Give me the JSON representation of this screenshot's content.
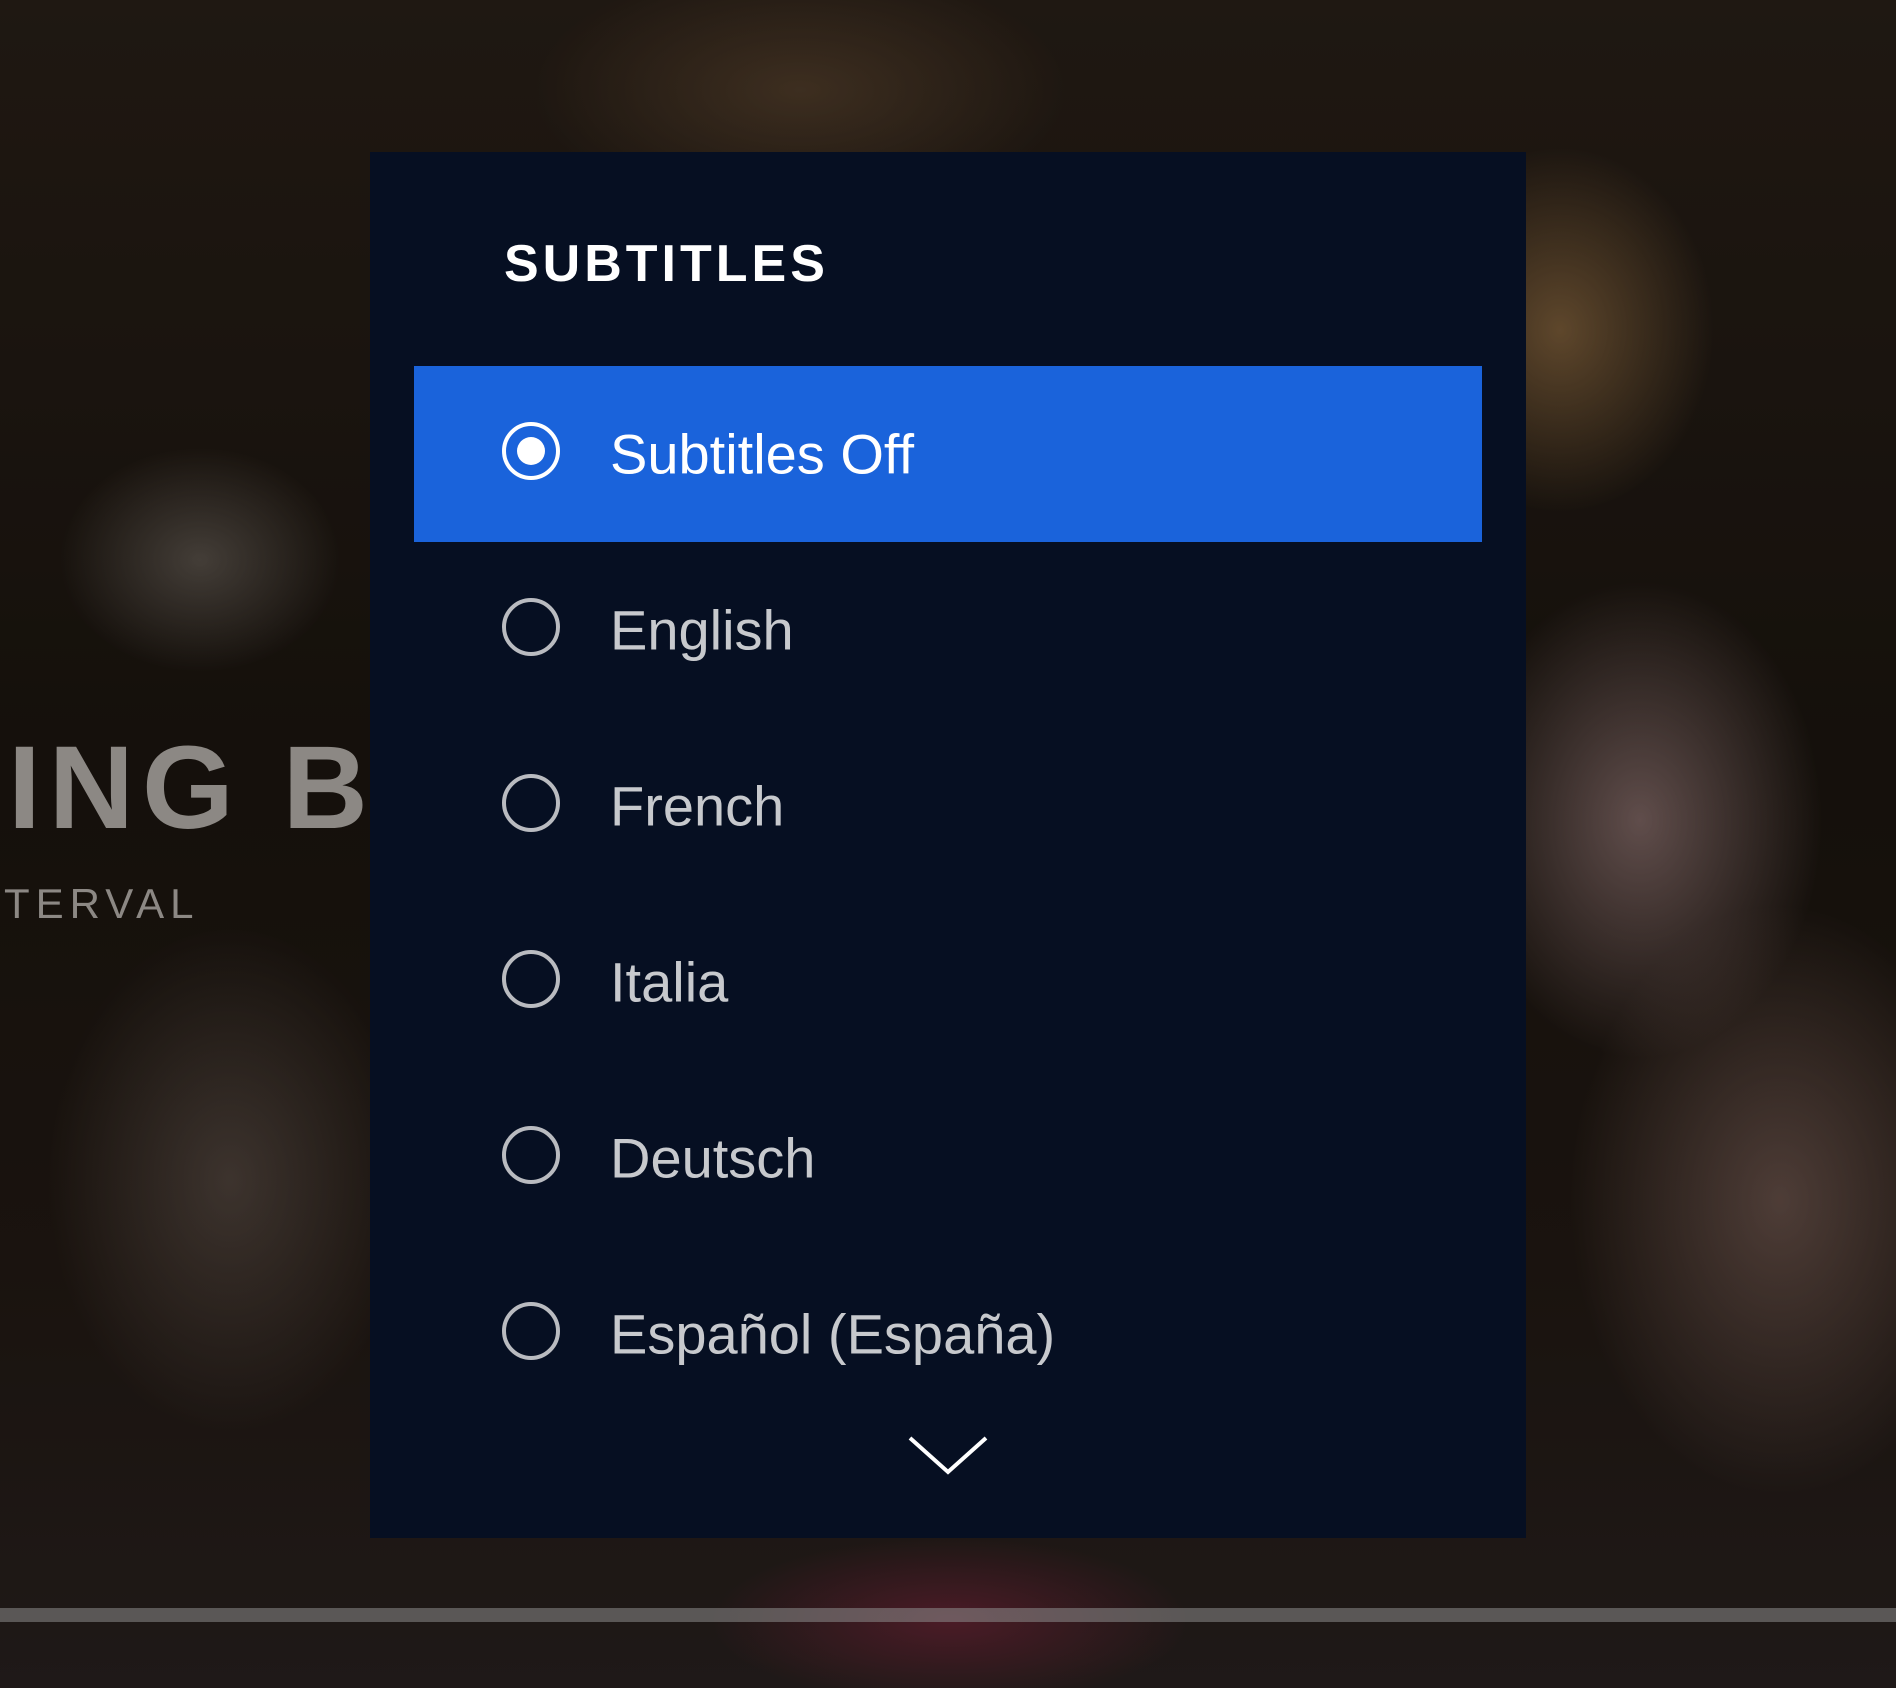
{
  "background": {
    "title_fragment": "ING B",
    "subtitle_fragment": "TERVAL"
  },
  "subtitles_menu": {
    "title": "SUBTITLES",
    "selected_index": 0,
    "options": [
      {
        "label": "Subtitles Off",
        "selected": true
      },
      {
        "label": "English",
        "selected": false
      },
      {
        "label": "French",
        "selected": false
      },
      {
        "label": "Italia",
        "selected": false
      },
      {
        "label": "Deutsch",
        "selected": false
      },
      {
        "label": "Español (España)",
        "selected": false
      }
    ],
    "scroll_icon": "chevron-down-icon"
  },
  "colors": {
    "panel_bg": "#060f22",
    "selected_bg": "#1a63db",
    "text": "#ffffff",
    "text_muted": "#c7c9cd"
  }
}
